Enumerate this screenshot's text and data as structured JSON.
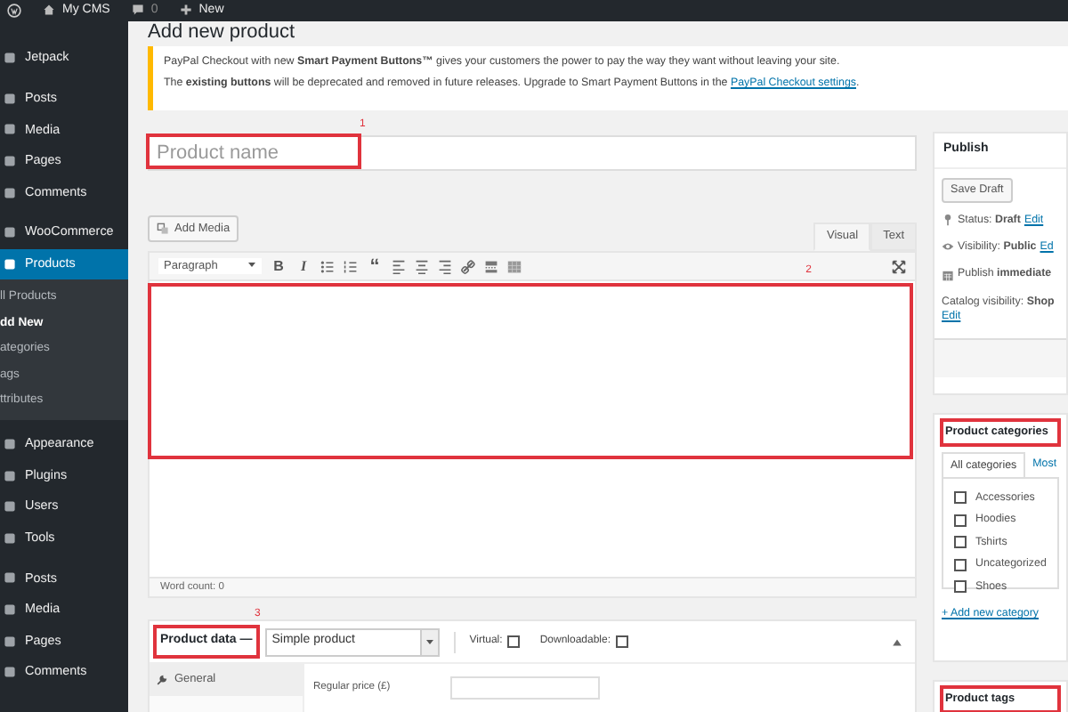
{
  "admin_bar": {
    "site": "My CMS",
    "comments": "0",
    "new": "New"
  },
  "sidebar": {
    "groups": [
      {
        "items": [
          {
            "label": "Jetpack",
            "selected": false
          }
        ]
      },
      {
        "items": [
          {
            "label": "Posts",
            "selected": false
          },
          {
            "label": "Media",
            "selected": false
          },
          {
            "label": "Pages",
            "selected": false
          },
          {
            "label": "Comments",
            "selected": false
          }
        ]
      },
      {
        "items": [
          {
            "label": "WooCommerce",
            "selected": false
          },
          {
            "label": "Products",
            "selected": true,
            "children": [
              {
                "label": "ll Products",
                "selected": false
              },
              {
                "label": "dd New",
                "selected": true
              },
              {
                "label": "ategories",
                "selected": false
              },
              {
                "label": "ags",
                "selected": false
              },
              {
                "label": "ttributes",
                "selected": false
              }
            ]
          }
        ]
      },
      {
        "items": [
          {
            "label": "Appearance",
            "selected": false
          },
          {
            "label": "Plugins",
            "selected": false
          },
          {
            "label": "Users",
            "selected": false
          },
          {
            "label": "Tools",
            "selected": false
          }
        ]
      },
      {
        "items": [
          {
            "label": "Posts",
            "selected": false
          },
          {
            "label": "Media",
            "selected": false
          },
          {
            "label": "Pages",
            "selected": false
          },
          {
            "label": "Comments",
            "selected": false
          }
        ]
      }
    ]
  },
  "page_title": "Add new product",
  "notice": {
    "line_1": "PayPal Checkout with new **Smart Payment Buttons™** gives your customers the power to pay the way they want without leaving your site.",
    "line_2": "The **existing buttons** will be deprecated and removed in future releases. Upgrade to Smart Payment Buttons in the",
    "link": "PayPal Checkout settings",
    "line_2_end": "."
  },
  "title_field": {
    "placeholder": "Product name",
    "marker": "1"
  },
  "editor": {
    "add_media": "Add Media",
    "tabs": [
      {
        "label": "Visual",
        "selected": true
      },
      {
        "label": "Text",
        "selected": false
      }
    ],
    "format": "Paragraph",
    "toolbar": [
      {
        "kind": "bold",
        "label": "B"
      },
      {
        "kind": "italic",
        "label": "I"
      },
      {
        "kind": "bullets"
      },
      {
        "kind": "numbers"
      },
      {
        "kind": "quote",
        "label": "“"
      },
      {
        "kind": "align-left"
      },
      {
        "kind": "align-center"
      },
      {
        "kind": "align-right"
      },
      {
        "kind": "link"
      },
      {
        "kind": "more"
      },
      {
        "kind": "kitchen-sink"
      }
    ],
    "marker": "2",
    "word_count": "Word count: 0"
  },
  "product_data": {
    "label": "Product data —",
    "marker": "3",
    "type": "Simple product",
    "options": [
      {
        "label": "Virtual:",
        "checked": false
      },
      {
        "label": "Downloadable:",
        "checked": false
      }
    ],
    "tabs": [
      {
        "label": "General",
        "selected": true
      }
    ],
    "fields": [
      {
        "label": "Regular price (£)"
      }
    ]
  },
  "publish": {
    "title": "Publish",
    "save_draft": "Save Draft",
    "rows": [
      {
        "kind": "status",
        "text": "Status: **Draft**",
        "link": "Edit"
      },
      {
        "kind": "visibility",
        "text": "Visibility: **Public**",
        "link": "Ed"
      },
      {
        "kind": "schedule",
        "text": "Publish **immediate**"
      },
      {
        "kind": "catalog",
        "text": "Catalog visibility: **Shop**",
        "link": "Edit"
      }
    ]
  },
  "categories": {
    "title": "Product categories",
    "tabs": [
      {
        "label": "All categories",
        "selected": true
      },
      {
        "label": "Most",
        "selected": false
      }
    ],
    "items": [
      {
        "label": "Accessories",
        "checked": false
      },
      {
        "label": "Hoodies",
        "checked": false
      },
      {
        "label": "Tshirts",
        "checked": false
      },
      {
        "label": "Uncategorized",
        "checked": false
      },
      {
        "label": "Shoes",
        "checked": false
      }
    ],
    "add_link": "+ Add new category"
  },
  "tags": {
    "title": "Product tags"
  }
}
